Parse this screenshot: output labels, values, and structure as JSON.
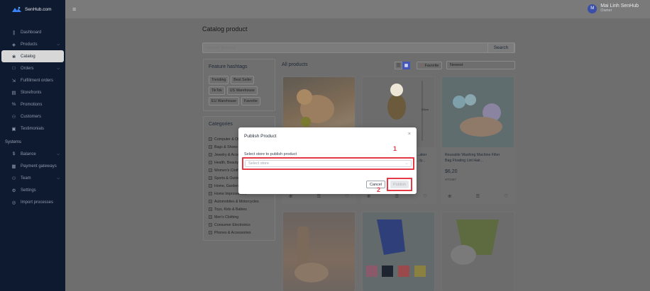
{
  "app": {
    "brand": "SenHub.com"
  },
  "user": {
    "name": "Mai Linh SenHub",
    "role": "Owner",
    "initial": "M"
  },
  "sidebar": {
    "items": [
      {
        "label": "Dashboard",
        "icon": "bar-chart-icon",
        "glyph": "∥"
      },
      {
        "label": "Products",
        "icon": "box-icon",
        "glyph": "◈",
        "chevron": true
      },
      {
        "label": "Catalog",
        "icon": "catalog-icon",
        "glyph": "❀",
        "active": true
      },
      {
        "label": "Orders",
        "icon": "orders-icon",
        "glyph": "□",
        "chevron": true
      },
      {
        "label": "Fulfillment orders",
        "icon": "truck-icon",
        "glyph": "⇲"
      },
      {
        "label": "Storefronts",
        "icon": "store-icon",
        "glyph": "▤"
      },
      {
        "label": "Promotions",
        "icon": "percent-icon",
        "glyph": "%"
      },
      {
        "label": "Customers",
        "icon": "users-icon",
        "glyph": "⚇"
      },
      {
        "label": "Testimonials",
        "icon": "chat-icon",
        "glyph": "▣"
      }
    ],
    "section": "Systems",
    "system_items": [
      {
        "label": "Balance",
        "icon": "dollar-icon",
        "glyph": "$",
        "chevron": true
      },
      {
        "label": "Payment gateways",
        "icon": "card-icon",
        "glyph": "▦"
      },
      {
        "label": "Team",
        "icon": "team-icon",
        "glyph": "⚇",
        "chevron": true
      },
      {
        "label": "Settings",
        "icon": "settings-icon",
        "glyph": "⚙"
      },
      {
        "label": "Import processes",
        "icon": "import-icon",
        "glyph": "◎"
      }
    ]
  },
  "main": {
    "title": "Catalog product",
    "search": {
      "placeholder": "Search product",
      "button": "Search"
    },
    "hashtags": {
      "title": "Feature hashtags",
      "tags": [
        "Trending",
        "Best Seller",
        "TikTok",
        "US Warehouse",
        "EU Warehouse",
        "Favorite"
      ]
    },
    "categories": {
      "title": "Categories",
      "items": [
        "Computer & Office",
        "Bags & Shoes",
        "Jewelry & Accessories",
        "Health, Beauty & Hair",
        "Women's Clothing",
        "Sports & Outdoors",
        "Home, Garden & Furniture",
        "Home Improvement",
        "Automobiles & Motorcycles",
        "Toys, Kids & Babies",
        "Men's Clothing",
        "Consumer Electronics",
        "Phones & Accessories"
      ]
    },
    "products_header": "All products",
    "favorite_label": "Favorite",
    "sort_value": "Newest",
    "products": [
      {
        "title": "",
        "price": "",
        "sku": ""
      },
      {
        "title": "...aker ...ty...",
        "price": "",
        "sku": "",
        "dim": "23cm"
      },
      {
        "title": "Reusable Washing Machine Filter Bag Floating Lint Hair...",
        "price": "$6,20",
        "sku": "HT0487"
      },
      {
        "title": "",
        "price": "",
        "sku": ""
      },
      {
        "title": "",
        "price": "",
        "sku": ""
      },
      {
        "title": "",
        "price": "",
        "sku": ""
      }
    ]
  },
  "modal": {
    "title": "Publish Product",
    "label": "Select store to publish product",
    "select_placeholder": "Select store",
    "cancel": "Cancel",
    "publish": "Publish",
    "marker1": "1",
    "marker2": "2"
  },
  "colors": {
    "accent": "#4456b8",
    "highlight": "#e63946",
    "sidebar": "#0e1a30"
  }
}
